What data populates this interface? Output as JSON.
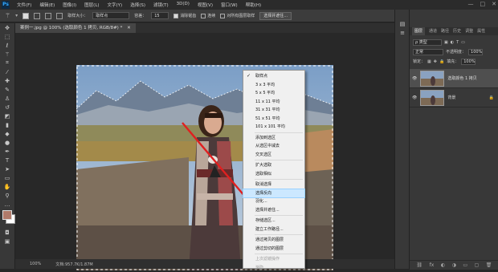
{
  "app": {
    "logo": "Ps",
    "window_controls": [
      "—",
      "□",
      "✕"
    ]
  },
  "menubar": {
    "items": [
      "文件(F)",
      "编辑(E)",
      "图像(I)",
      "图层(L)",
      "文字(Y)",
      "选择(S)",
      "滤镜(T)",
      "3D(D)",
      "视图(V)",
      "窗口(W)",
      "帮助(H)"
    ]
  },
  "options": {
    "sample_size_label": "取样大小：",
    "sample_size_value": "取样点",
    "tolerance_label": "容差：",
    "tolerance_value": "15",
    "antialias_label": "消除锯齿",
    "antialias_checked": true,
    "contiguous_label": "连续",
    "contiguous_checked": false,
    "sample_all_label": "对所有图层取样",
    "sample_all_checked": false,
    "select_mask_label": "选择并遮住..."
  },
  "document": {
    "tab_title": "案例一.jpg @ 100% (选取颜色 1 拷贝, RGB/8#) *",
    "zoom": "100%",
    "doc_info": "文档:957.7K/1.87M"
  },
  "colors": {
    "foreground": "#b07a6a",
    "background": "#ffffff",
    "accent": "#cce8ff",
    "arrow": "#e02020"
  },
  "panels": {
    "tabs": [
      "图层",
      "通道",
      "路径",
      "历史",
      "调整",
      "属性"
    ],
    "kind_label": "ρ 类型",
    "blend_mode": "正常",
    "opacity_label": "不透明度：",
    "opacity_value": "100%",
    "lock_label": "锁定：",
    "fill_label": "填充：",
    "fill_value": "100%",
    "layers": [
      {
        "name": "选取颜色 1 拷贝",
        "selected": true
      },
      {
        "name": "背景",
        "selected": false,
        "locked": true
      }
    ],
    "bottom_icons": [
      "⛓",
      "fx",
      "◐",
      "◑",
      "▭",
      "▢",
      "🗑"
    ]
  },
  "context_menu": {
    "items": [
      {
        "label": "取样点",
        "checked": true
      },
      {
        "label": "3 x 3 平均"
      },
      {
        "label": "5 x 5 平均"
      },
      {
        "label": "11 x 11 平均"
      },
      {
        "label": "31 x 31 平均"
      },
      {
        "label": "51 x 51 平均"
      },
      {
        "label": "101 x 101 平均",
        "sep_after": true
      },
      {
        "label": "添加到选区"
      },
      {
        "label": "从选区中减去"
      },
      {
        "label": "交叉选区",
        "sep_after": true
      },
      {
        "label": "扩大选取"
      },
      {
        "label": "选取相似",
        "sep_after": true
      },
      {
        "label": "取消选择"
      },
      {
        "label": "选择反向",
        "highlighted": true
      },
      {
        "label": "羽化..."
      },
      {
        "label": "选择并遮住...",
        "sep_after": true
      },
      {
        "label": "存储选区..."
      },
      {
        "label": "建立工作路径...",
        "sep_after": true
      },
      {
        "label": "通过拷贝的图层"
      },
      {
        "label": "通过剪切的图层",
        "sep_after": true
      },
      {
        "label": "上次滤镜操作",
        "disabled": true
      },
      {
        "label": "渐隐...",
        "disabled": true
      }
    ]
  }
}
